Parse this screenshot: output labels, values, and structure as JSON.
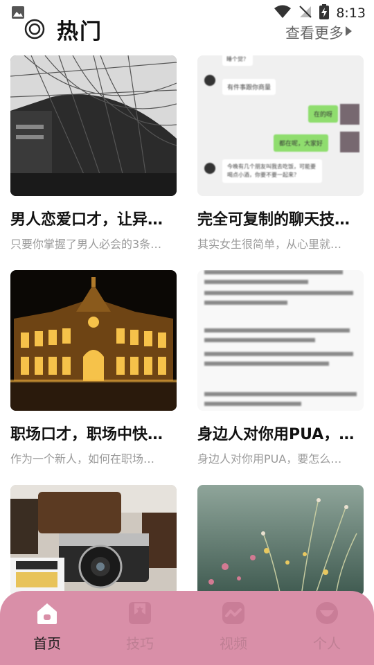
{
  "status_bar": {
    "time": "8:13"
  },
  "header": {
    "title": "热门",
    "more_label": "查看更多"
  },
  "cards": [
    {
      "title": "男人恋爱口才，让异…",
      "desc": "只要你掌握了男人必会的3条…"
    },
    {
      "title": "完全可复制的聊天技…",
      "desc": "其实女生很简单，从心里就…"
    },
    {
      "title": "职场口才，职场中快…",
      "desc": "作为一个新人，如何在职场…"
    },
    {
      "title": "身边人对你用PUA，…",
      "desc": "身边人对你用PUA，要怎么…"
    }
  ],
  "chat_preview": {
    "messages": [
      "睡个觉？",
      "有件事跟你商量",
      "在的呀",
      "都在呢，大家好",
      "今晚有几个朋友叫我去吃饭，可能要喝点小酒，你要不要一起来？"
    ]
  },
  "nav": {
    "items": [
      {
        "label": "首页",
        "icon": "home-icon",
        "active": true
      },
      {
        "label": "技巧",
        "icon": "bookmark-star-icon",
        "active": false
      },
      {
        "label": "视频",
        "icon": "video-icon",
        "active": false
      },
      {
        "label": "个人",
        "icon": "profile-icon",
        "active": false
      }
    ]
  },
  "colors": {
    "nav_background": "#d98fa8",
    "nav_inactive": "#bf7f94",
    "nav_active": "#1a1a1a",
    "desc_text": "#9a9a9a"
  }
}
